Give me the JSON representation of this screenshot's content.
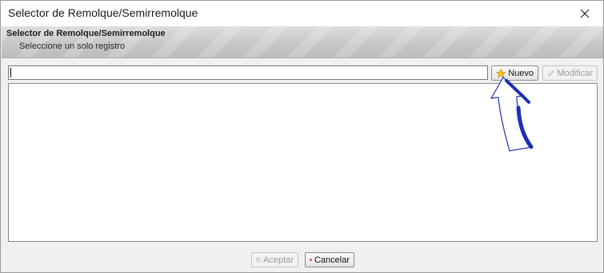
{
  "window": {
    "title": "Selector de Remolque/Semirremolque",
    "close_glyph": "✕"
  },
  "header": {
    "title": "Selector de Remolque/Semirremolque",
    "subtitle": "Seleccione un solo registro"
  },
  "search": {
    "value": "",
    "placeholder": ""
  },
  "toolbar": {
    "new_label": "Nuevo",
    "new_icon": "star-icon",
    "edit_label": "Modificar",
    "edit_icon": "pencil-icon",
    "edit_enabled": false
  },
  "list": {
    "rows": []
  },
  "footer": {
    "accept_label": "Aceptar",
    "accept_icon": "check-circle-icon",
    "accept_enabled": false,
    "cancel_label": "Cancelar",
    "cancel_icon": "cancel-circle-icon"
  },
  "annotation": {
    "arrow_color": "#1c2fb5"
  }
}
